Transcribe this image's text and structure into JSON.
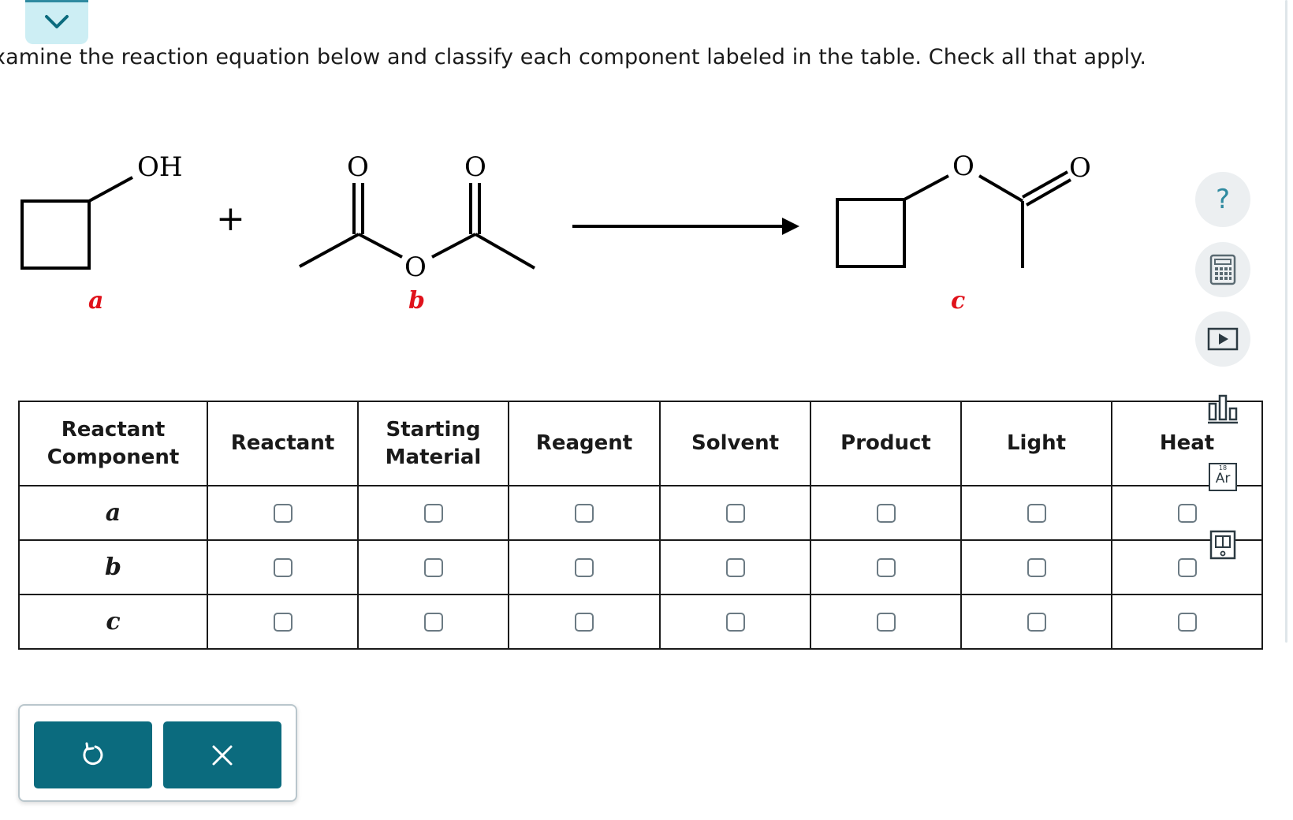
{
  "instructions": "xamine the reaction equation below and classify each component labeled in the table. Check all that apply.",
  "scheme": {
    "oh_label": "OH",
    "plus": "+",
    "o_label": "O",
    "labels": [
      "a",
      "b",
      "c"
    ]
  },
  "table": {
    "corner_line1": "Reactant",
    "corner_line2": "Component",
    "columns": [
      {
        "line1": "Reactant",
        "line2": ""
      },
      {
        "line1": "Starting",
        "line2": "Material"
      },
      {
        "line1": "Reagent",
        "line2": ""
      },
      {
        "line1": "Solvent",
        "line2": ""
      },
      {
        "line1": "Product",
        "line2": ""
      },
      {
        "line1": "Light",
        "line2": ""
      },
      {
        "line1": "Heat",
        "line2": ""
      }
    ],
    "rows": [
      "a",
      "b",
      "c"
    ]
  },
  "tools": [
    {
      "icon": "help-icon",
      "glyph": "?"
    },
    {
      "icon": "calculator-icon"
    },
    {
      "icon": "video-icon"
    },
    {
      "icon": "chart-icon"
    },
    {
      "icon": "periodic-table-icon",
      "number": "18",
      "symbol": "Ar"
    },
    {
      "icon": "textbook-icon"
    }
  ],
  "colors": {
    "label_red": "#e0121b",
    "button_teal": "#0b6b7e",
    "tab_bg": "#cdeef4"
  }
}
